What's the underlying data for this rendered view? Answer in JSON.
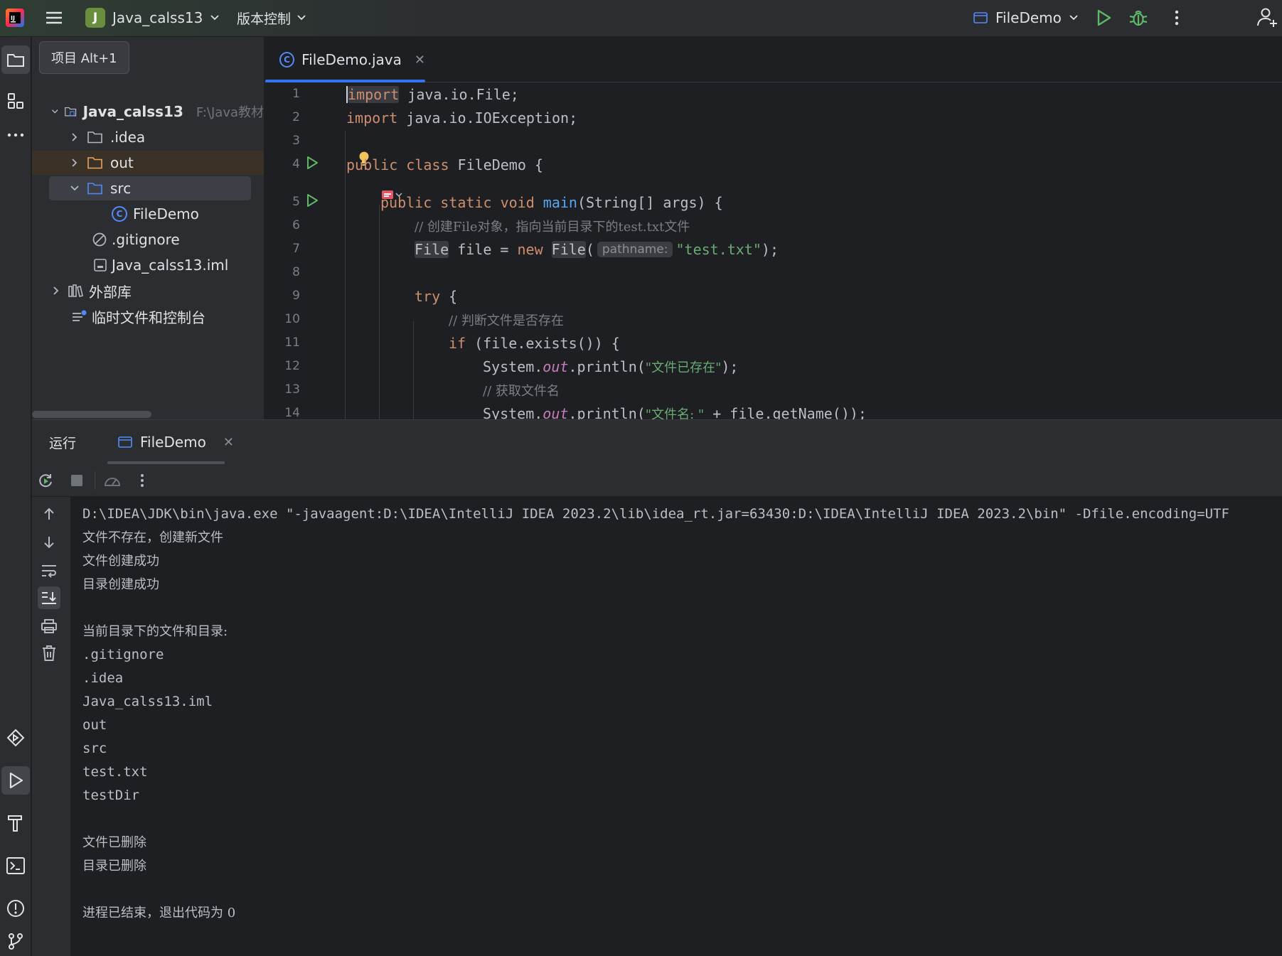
{
  "titlebar": {
    "project_badge": "J",
    "project_name": "Java_calss13",
    "vcs_label": "版本控制",
    "run_config": "FileDemo"
  },
  "project_panel": {
    "tooltip": "项目  Alt+1",
    "tree": [
      {
        "label": "Java_calss13",
        "hint": "F:\\Java教材",
        "kind": "module"
      },
      {
        "label": ".idea",
        "kind": "folder"
      },
      {
        "label": "out",
        "kind": "folder"
      },
      {
        "label": "src",
        "kind": "folder"
      },
      {
        "label": "FileDemo",
        "kind": "class"
      },
      {
        "label": ".gitignore",
        "kind": "ignore"
      },
      {
        "label": "Java_calss13.iml",
        "kind": "file"
      },
      {
        "label": "外部库",
        "kind": "library"
      },
      {
        "label": "临时文件和控制台",
        "kind": "scratch"
      }
    ]
  },
  "editor": {
    "tab_label": "FileDemo.java",
    "line_numbers": [
      "1",
      "2",
      "3",
      "4",
      "5",
      "6",
      "7",
      "8",
      "9",
      "10",
      "11",
      "12",
      "13",
      "14"
    ],
    "lines": {
      "l1_kw": "import",
      "l1_rest": " java.io.File;",
      "l2_kw": "import",
      "l2_rest": " java.io.IOException;",
      "l4_kw": "public class",
      "l4_rest": " FileDemo {",
      "l5_kw": "public static void",
      "l5_fn": "main",
      "l5_rest": "(String[] args) {",
      "l6_comment": "// 创建File对象，指向当前目录下的test.txt文件",
      "l7_type": "File",
      "l7_mid": " file = ",
      "l7_new": "new",
      "l7_ctor": "File",
      "l7_paren": "(",
      "l7_hint": "pathname:",
      "l7_str": "\"test.txt\"",
      "l7_end": ");",
      "l9_kw": "try",
      "l9_rest": " {",
      "l10_comment": "// 判断文件是否存在",
      "l11_kw": "if",
      "l11_rest": " (file.exists()) {",
      "l12_a": "System.",
      "l12_field": "out",
      "l12_b": ".println(",
      "l12_str": "\"文件已存在\"",
      "l12_c": ");",
      "l13_comment": "// 获取文件名",
      "l14_a": "System.",
      "l14_field": "out",
      "l14_b": ".println(",
      "l14_str": "\"文件名: \"",
      "l14_c": " + file.getName());"
    }
  },
  "run_window": {
    "title": "运行",
    "tab_label": "FileDemo",
    "console_lines": [
      "D:\\IDEA\\JDK\\bin\\java.exe \"-javaagent:D:\\IDEA\\IntelliJ IDEA 2023.2\\lib\\idea_rt.jar=63430:D:\\IDEA\\IntelliJ IDEA 2023.2\\bin\" -Dfile.encoding=UTF",
      "文件不存在，创建新文件",
      "文件创建成功",
      "目录创建成功",
      "",
      "当前目录下的文件和目录:",
      ".gitignore",
      ".idea",
      "Java_calss13.iml",
      "out",
      "src",
      "test.txt",
      "testDir",
      "",
      "文件已删除",
      "目录已删除",
      "",
      "进程已结束，退出代码为 0"
    ]
  },
  "colors": {
    "accent": "#3574f0",
    "run_green": "#5fb865",
    "keyword": "#cf8e6d",
    "string": "#6aab73",
    "function": "#56a8f5"
  }
}
